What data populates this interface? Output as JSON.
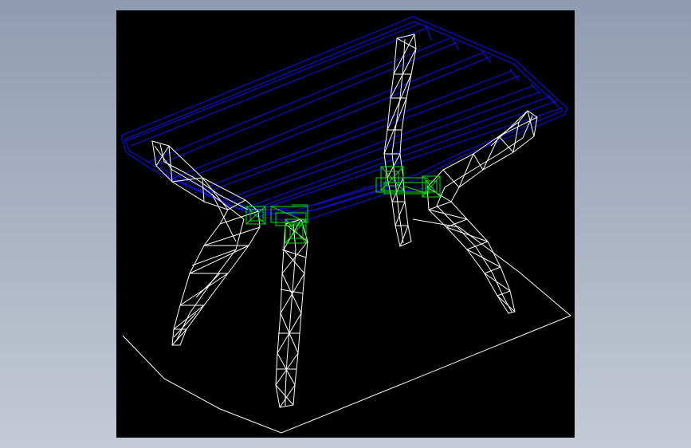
{
  "viewport": {
    "background": "#000000",
    "colors": {
      "tabletop": "#1010e0",
      "legs": "#ffffff",
      "joints": "#00e000",
      "ground_outline": "#ffffff"
    }
  },
  "app": {
    "background_top": "#8f9bb1",
    "background_bottom": "#c4cad5"
  }
}
